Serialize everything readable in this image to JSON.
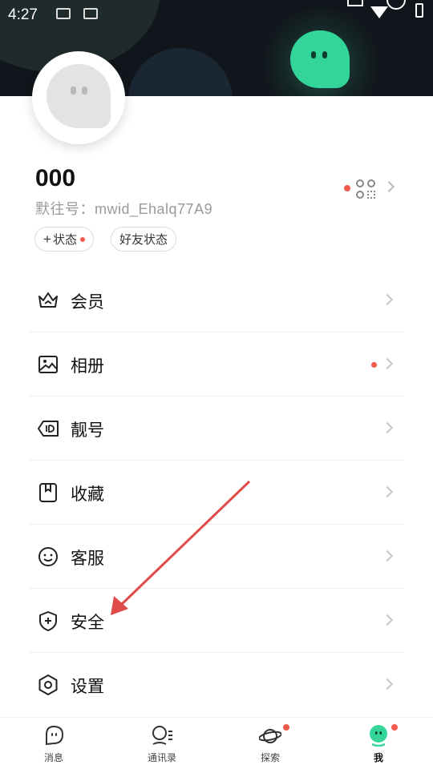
{
  "status_bar": {
    "time": "4:27"
  },
  "profile": {
    "name": "000",
    "id_line": "默往号：mwid_Ehalq77A9",
    "chips": [
      {
        "label": "状态",
        "prefix": "+"
      },
      {
        "label": "好友状态"
      }
    ]
  },
  "menu": {
    "items": [
      {
        "label": "会员",
        "icon": "crown-icon"
      },
      {
        "label": "相册",
        "icon": "image-icon",
        "badge": true
      },
      {
        "label": "靓号",
        "icon": "id-tag-icon"
      },
      {
        "label": "收藏",
        "icon": "bookmark-icon"
      },
      {
        "label": "客服",
        "icon": "service-face-icon"
      },
      {
        "label": "安全",
        "icon": "shield-plus-icon"
      },
      {
        "label": "设置",
        "icon": "settings-hex-icon"
      }
    ]
  },
  "tabbar": {
    "tabs": [
      {
        "label": "消息",
        "icon": "message-bubble-icon"
      },
      {
        "label": "通讯录",
        "icon": "contacts-icon"
      },
      {
        "label": "探索",
        "icon": "planet-icon",
        "badge": true
      },
      {
        "label": "我",
        "icon": "me-mascot-icon",
        "badge": true,
        "active": true
      }
    ]
  },
  "colors": {
    "accent_green": "#33d59a",
    "badge_red": "#f05a4e",
    "annotation_arrow": "#e04a48"
  }
}
